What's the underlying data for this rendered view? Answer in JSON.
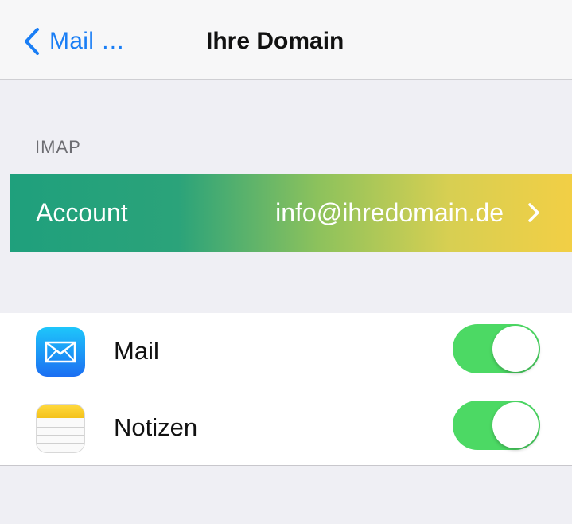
{
  "navbar": {
    "back_label": "Mail …",
    "title": "Ihre Domain"
  },
  "section": {
    "header": "IMAP"
  },
  "account": {
    "label": "Account",
    "value": "info@ihredomain.de"
  },
  "sync_items": [
    {
      "label": "Mail",
      "icon": "mail-app-icon",
      "enabled": true
    },
    {
      "label": "Notizen",
      "icon": "notes-app-icon",
      "enabled": true
    }
  ],
  "colors": {
    "tint": "#1a7ef5",
    "toggle_on": "#4cd964",
    "gradient_start": "#1fa07c",
    "gradient_end": "#f2cf45"
  }
}
